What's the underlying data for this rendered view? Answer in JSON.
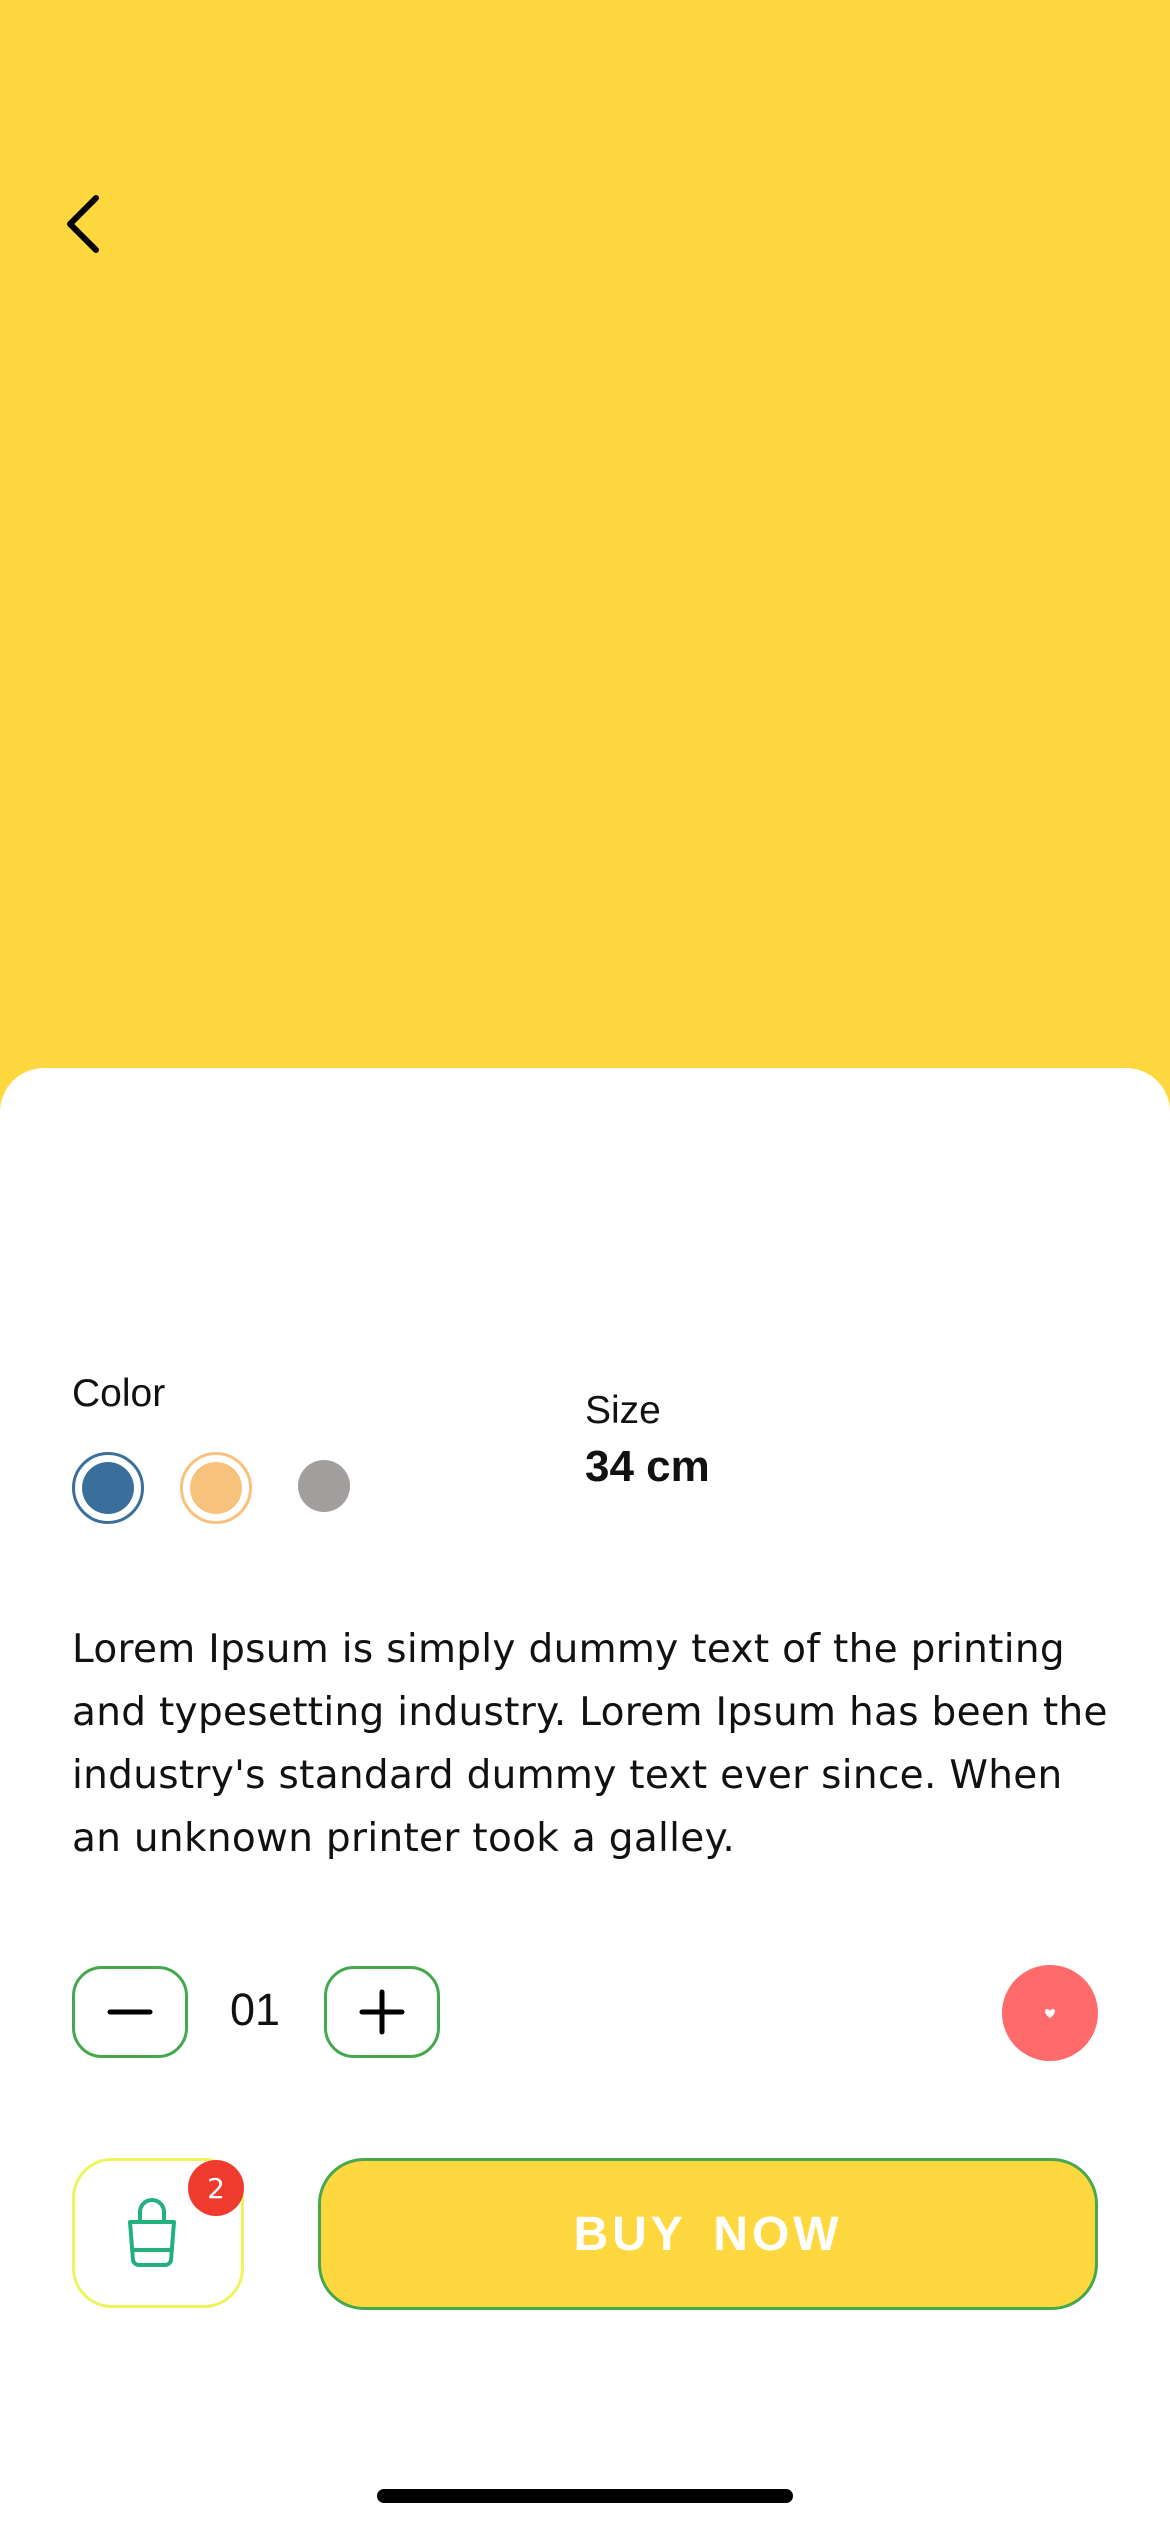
{
  "header": {
    "back_icon": "chevron-left-icon"
  },
  "product": {
    "color_label": "Color",
    "colors": [
      {
        "name": "blue",
        "hex": "#3A6F9C",
        "selected": true
      },
      {
        "name": "orange",
        "hex": "#F8C27E",
        "selected": false
      },
      {
        "name": "gray",
        "hex": "#A39E9E",
        "selected": false
      }
    ],
    "size_label": "Size",
    "size_value": "34 cm",
    "description": "Lorem Ipsum is simply dummy text of the printing and typesetting industry. Lorem Ipsum has been the industry's standard dummy text ever since. When an unknown printer took a galley."
  },
  "quantity": {
    "value": "01",
    "decrement_icon": "minus-icon",
    "increment_icon": "plus-icon"
  },
  "favorite": {
    "icon": "heart-icon",
    "color": "#FF6B6B"
  },
  "cart": {
    "icon": "shopping-bag-icon",
    "badge_count": "2"
  },
  "buy_button": {
    "label": "BUY  NOW"
  },
  "colors": {
    "hero_bg": "#FFD83F",
    "accent_green": "#46A84C",
    "badge_red": "#EF3B2D"
  }
}
